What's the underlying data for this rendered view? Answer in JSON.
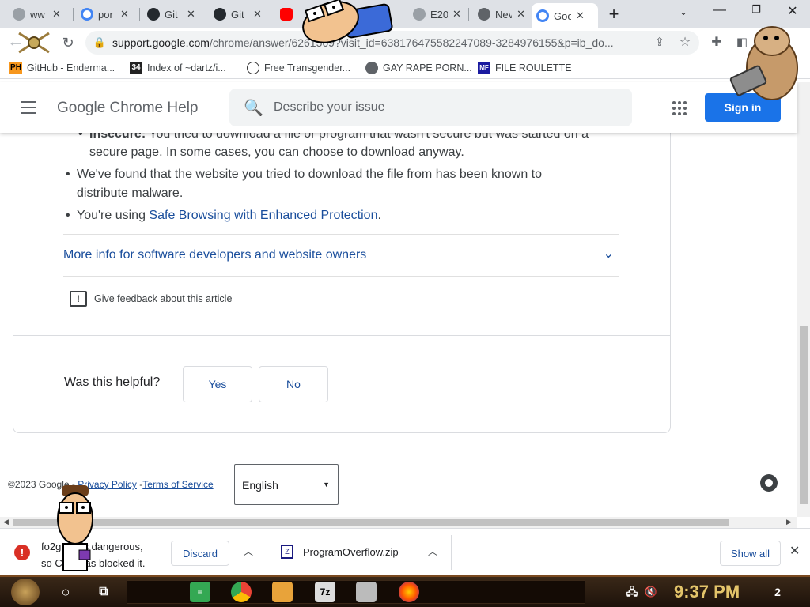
{
  "tabs": [
    {
      "title": "ww",
      "favicon": "globe-icon"
    },
    {
      "title": "por",
      "favicon": "google-icon"
    },
    {
      "title": "Git",
      "favicon": "github-icon"
    },
    {
      "title": "Git",
      "favicon": "github-icon"
    },
    {
      "title": "",
      "favicon": "youtube-icon"
    },
    {
      "title": "E20",
      "favicon": "globe-icon"
    },
    {
      "title": "Nev",
      "favicon": "chrome-icon"
    },
    {
      "title": "Goo",
      "favicon": "google-icon",
      "active": true
    }
  ],
  "omnibox": {
    "domain": "support.google.com",
    "path": "/chrome/answer/6261569?visit_id=638176475582247089-3284976155&p=ib_do..."
  },
  "bookmarks": [
    {
      "label": "GitHub - Enderma...",
      "icon": "PH"
    },
    {
      "label": "Index of ~dartz/i...",
      "icon": "34"
    },
    {
      "label": "Free Transgender...",
      "icon": "mask-icon"
    },
    {
      "label": "GAY RAPE PORN...",
      "icon": "globe-icon"
    },
    {
      "label": "FILE ROULETTE",
      "icon": "MF"
    }
  ],
  "header": {
    "title": "Google Chrome Help",
    "search_placeholder": "Describe your issue",
    "signin_label": "Sign in"
  },
  "article": {
    "partial_bullet_bold": "Insecure:",
    "partial_bullet_rest": " You tried to download a file or program that wasn't secure but was started on a",
    "partial_bullet_cont": "secure page. In some cases, you can choose to download anyway.",
    "bullet2_line1": "We've found that the website you tried to download the file from has been known to",
    "bullet2_line2": "distribute malware.",
    "bullet3_prefix": "You're using ",
    "bullet3_link": "Safe Browsing with Enhanced Protection",
    "bullet3_suffix": ".",
    "more_info": "More info for software developers and website owners",
    "feedback": "Give feedback about this article"
  },
  "helpful": {
    "question": "Was this helpful?",
    "yes": "Yes",
    "no": "No"
  },
  "footer": {
    "copyright": "©2023 Google - ",
    "privacy": "Privacy Policy",
    "dash": " -",
    "terms": "Terms of Service",
    "language": "English"
  },
  "downloads": {
    "danger_line1": "fo2g... p is dangerous,",
    "danger_line2": "so Ch... has blocked it.",
    "discard": "Discard",
    "file2": "ProgramOverflow.zip",
    "show_all": "Show all"
  },
  "taskbar": {
    "clock": "9:37 PM",
    "notifications": "2"
  },
  "colors": {
    "accent": "#1a73e8",
    "link": "#1a4e9c",
    "danger": "#d93025"
  }
}
